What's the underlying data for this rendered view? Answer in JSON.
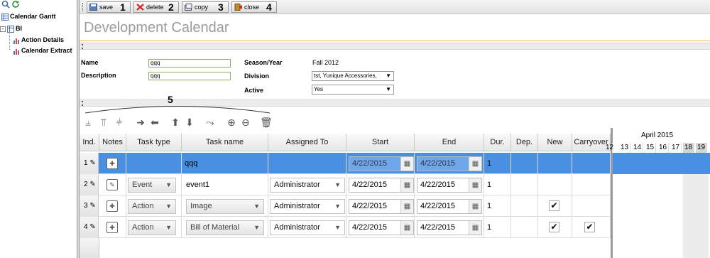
{
  "tree": {
    "items": [
      {
        "label": "Calendar Gantt"
      },
      {
        "label": "BI"
      },
      {
        "label": "Action Details"
      },
      {
        "label": "Calendar Extract"
      }
    ]
  },
  "toolbar": {
    "buttons": [
      {
        "label": "save",
        "number": "1"
      },
      {
        "label": "delete",
        "number": "2"
      },
      {
        "label": "copy",
        "number": "3"
      },
      {
        "label": "close",
        "number": "4"
      }
    ],
    "grid_toolbar_number": "5"
  },
  "page_title": "Development Calendar",
  "form": {
    "name_label": "Name",
    "name_value": "qqq",
    "description_label": "Description",
    "description_value": "qqq",
    "season_label": "Season/Year",
    "season_value": "Fall 2012",
    "division_label": "Division",
    "division_value": "tst, Yunique Accessories,",
    "active_label": "Active",
    "active_value": "Yes"
  },
  "grid": {
    "headers": [
      "Ind.",
      "Notes",
      "Task type",
      "Task name",
      "Assigned To",
      "Start",
      "End",
      "Dur.",
      "Dep.",
      "New",
      "Carryover"
    ],
    "rows": [
      {
        "ind": "1",
        "task_type": "",
        "task_name": "qqq",
        "assigned": "",
        "start": "4/22/2015",
        "end": "4/22/2015",
        "dur": "1",
        "new": false,
        "carryover": false
      },
      {
        "ind": "2",
        "task_type": "Event",
        "task_name": "event1",
        "assigned": "Administrator",
        "start": "4/22/2015",
        "end": "4/22/2015",
        "dur": "1",
        "new": false,
        "carryover": false
      },
      {
        "ind": "3",
        "task_type": "Action",
        "task_name": "Image",
        "assigned": "Administrator",
        "start": "4/22/2015",
        "end": "4/22/2015",
        "dur": "1",
        "new": true,
        "carryover": false
      },
      {
        "ind": "4",
        "task_type": "Action",
        "task_name": "Bill of Material",
        "assigned": "Administrator",
        "start": "4/22/2015",
        "end": "4/22/2015",
        "dur": "1",
        "new": true,
        "carryover": true
      }
    ]
  },
  "gantt": {
    "month": "April 2015",
    "days": [
      "12",
      "13",
      "14",
      "15",
      "16",
      "17",
      "18",
      "19"
    ]
  },
  "colors": {
    "selected_row": "#4a90e2",
    "title_line": "#e8c040"
  }
}
